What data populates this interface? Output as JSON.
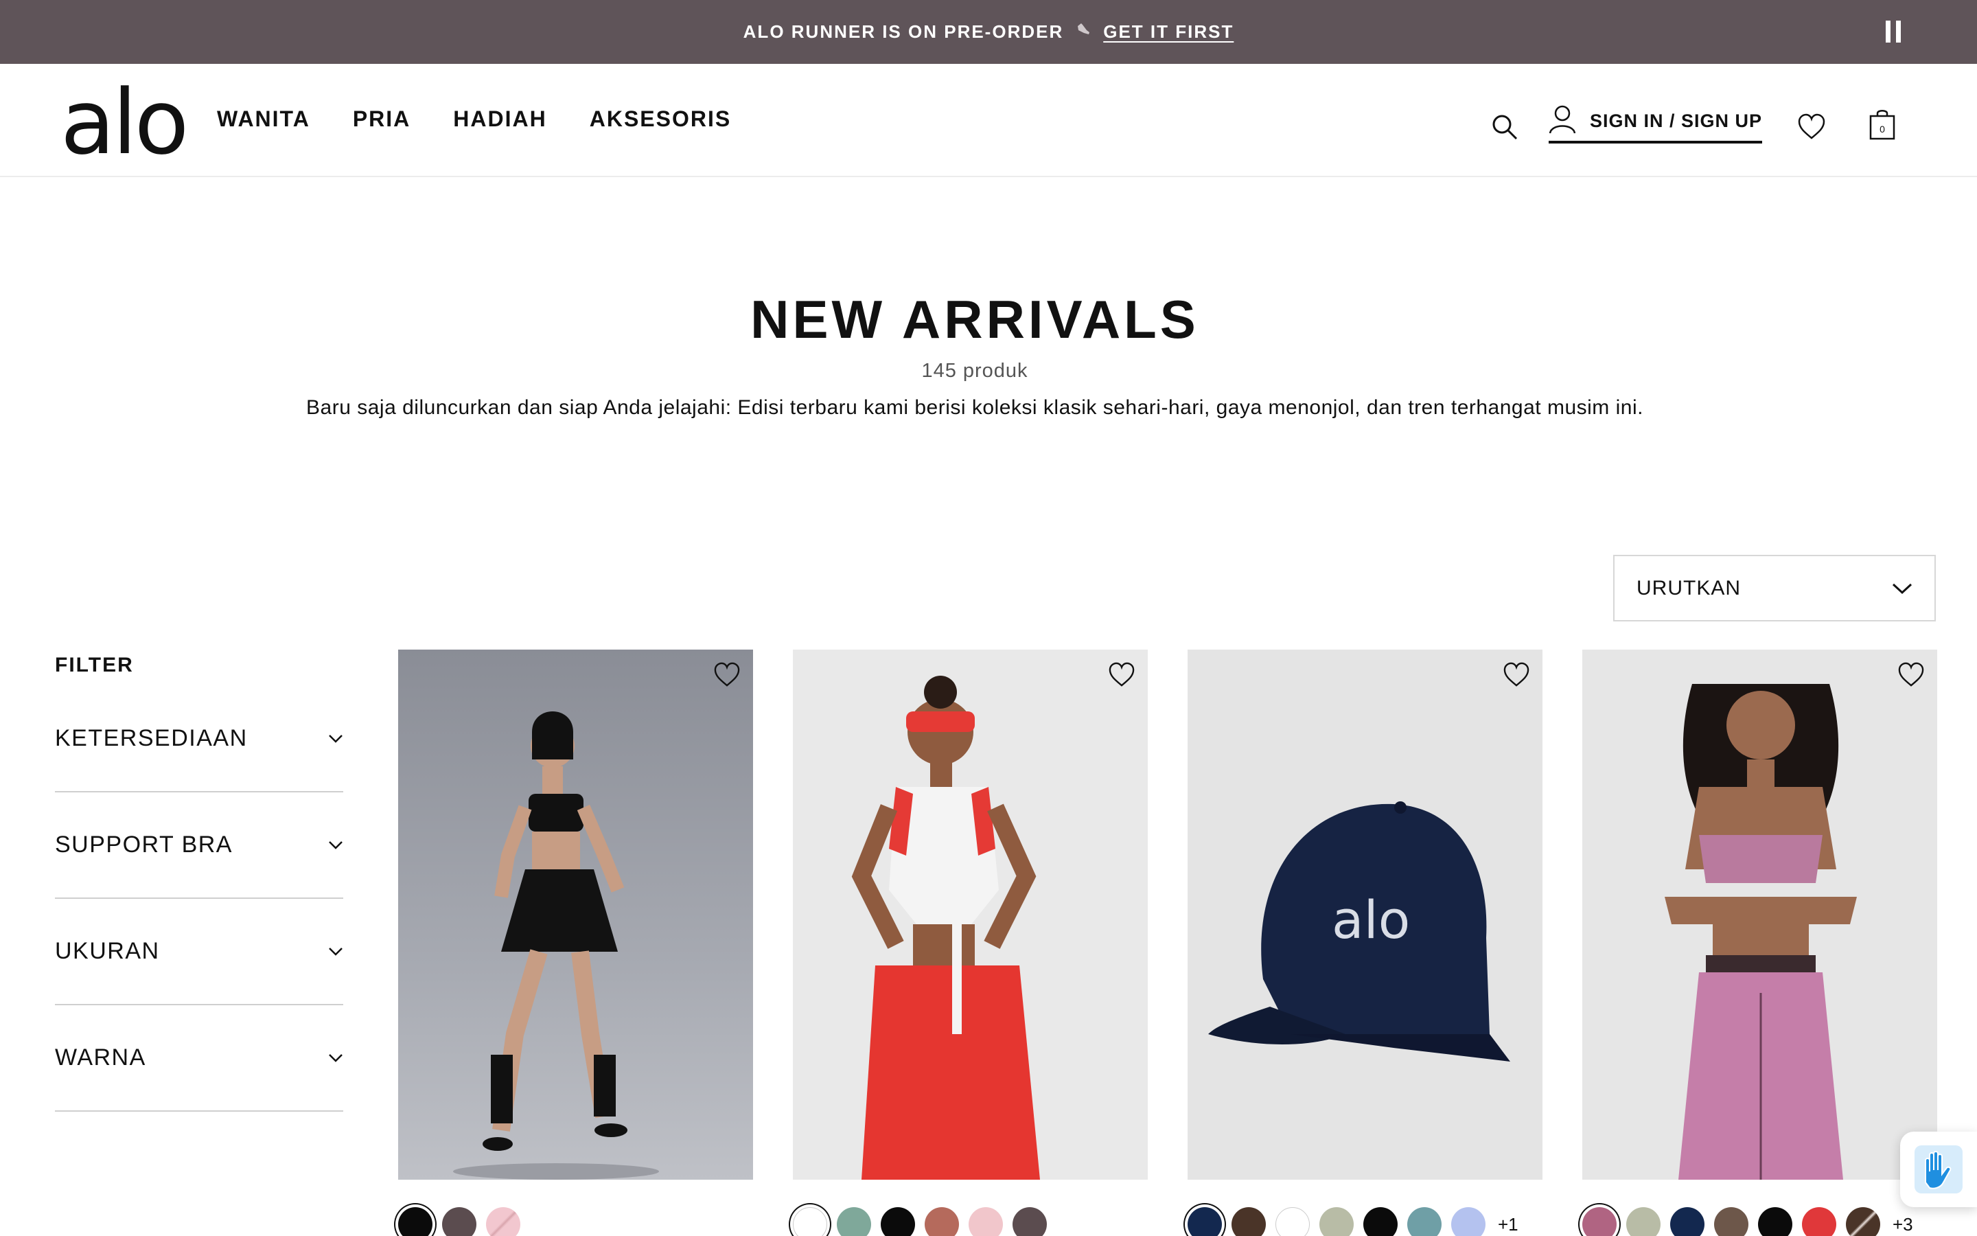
{
  "announcement": {
    "text": "ALO RUNNER IS ON PRE-ORDER",
    "link": "GET IT FIRST",
    "icon": "shoe-icon"
  },
  "header": {
    "logo": "alo",
    "nav": [
      "WANITA",
      "PRIA",
      "HADIAH",
      "AKSESORIS"
    ],
    "signin": "SIGN IN / SIGN UP",
    "cart_count": "0"
  },
  "page": {
    "title": "NEW ARRIVALS",
    "count": "145 produk",
    "description": "Baru saja diluncurkan dan siap Anda jelajahi: Edisi terbaru kami berisi koleksi klasik sehari-hari, gaya menonjol, dan tren terhangat musim ini."
  },
  "sort": {
    "label": "URUTKAN"
  },
  "filter": {
    "title": "FILTER",
    "groups": [
      "KETERSEDIAAN",
      "SUPPORT BRA",
      "UKURAN",
      "WARNA"
    ]
  },
  "products": [
    {
      "swatches": [
        "#0b0b0b",
        "#5b4c4f",
        "#f2c7cf"
      ],
      "more": ""
    },
    {
      "swatches": [
        "#ffffff",
        "#7fa89a",
        "#0b0b0b",
        "#b56a5c",
        "#f1c6cb",
        "#5b4c4f"
      ],
      "more": ""
    },
    {
      "swatches": [
        "#13284f",
        "#4a3428",
        "#ffffff",
        "#b8bca6",
        "#0b0b0b",
        "#6f9fa6",
        "#b4c2ef"
      ],
      "more": "+1"
    },
    {
      "swatches": [
        "#b06482",
        "#b8bca6",
        "#13284f",
        "#6d574a",
        "#0b0b0b",
        "#e0383a",
        "#4a3428"
      ],
      "more": "+3"
    }
  ],
  "colors": {
    "announcement_bg": "#5f5459",
    "accent": "#111111"
  }
}
